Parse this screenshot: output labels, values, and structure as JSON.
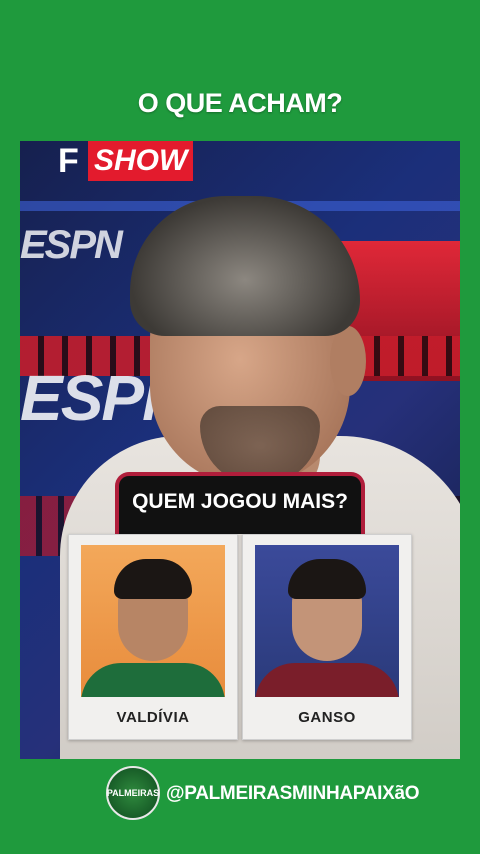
{
  "header": {
    "title": "O QUE ACHAM?"
  },
  "video": {
    "logo_letter": "F",
    "logo_show": "SHOW",
    "network_text": "ESPN",
    "poll": {
      "question": "QUEM JOGOU MAIS?",
      "options": [
        {
          "label": "VALDÍVIA"
        },
        {
          "label": "GANSO"
        }
      ]
    }
  },
  "footer": {
    "badge_text": "PALMEIRAS",
    "handle": "@PALMEIRASMINHAPAIXãO"
  },
  "colors": {
    "background": "#1f9a3d",
    "accent_red": "#e31b2d",
    "poll_border": "#b01e3b"
  }
}
